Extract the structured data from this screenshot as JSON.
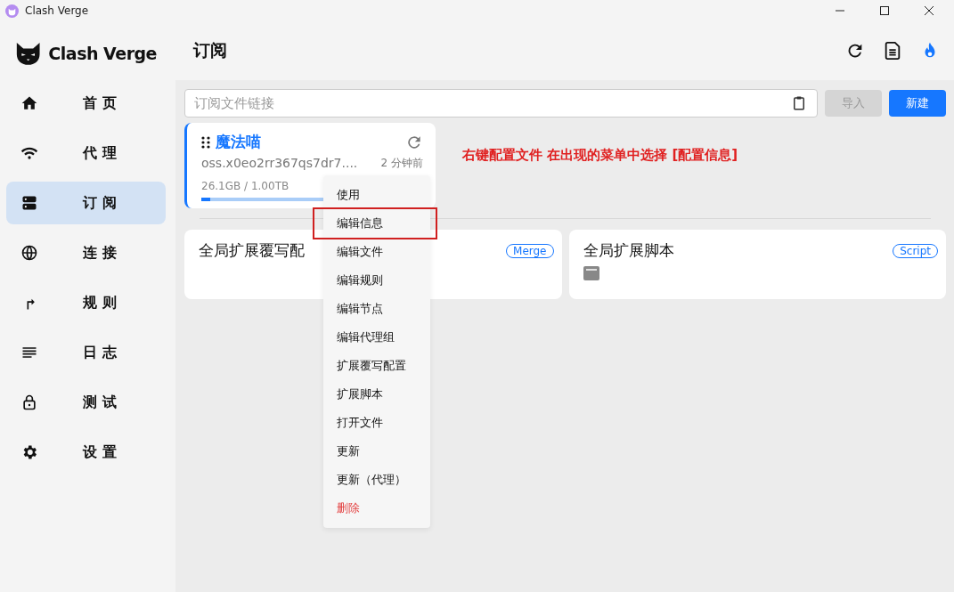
{
  "window": {
    "title": "Clash Verge"
  },
  "brand": {
    "name": "Clash Verge"
  },
  "sidebar": {
    "items": [
      {
        "kind": "home",
        "label": "首页",
        "selected": false
      },
      {
        "kind": "wifi",
        "label": "代理",
        "selected": false
      },
      {
        "kind": "server",
        "label": "订阅",
        "selected": true
      },
      {
        "kind": "globe",
        "label": "连接",
        "selected": false
      },
      {
        "kind": "route",
        "label": "规则",
        "selected": false
      },
      {
        "kind": "lines",
        "label": "日志",
        "selected": false
      },
      {
        "kind": "lock",
        "label": "测试",
        "selected": false
      },
      {
        "kind": "gear",
        "label": "设置",
        "selected": false
      }
    ]
  },
  "header": {
    "title": "订阅"
  },
  "import_bar": {
    "placeholder": "订阅文件链接",
    "import_button": {
      "label": "导入",
      "disabled": true
    },
    "new_button": {
      "label": "新建"
    }
  },
  "profile": {
    "name": "魔法喵",
    "selected": true,
    "url": "oss.x0eo2rr367qs7dr7....",
    "updated": "2 分钟前",
    "usage": "26.1GB / 1.00TB",
    "level": 0.026
  },
  "annotation": "右键配置文件 在出现的菜单中选择 [配置信息]",
  "enhance_cards": [
    {
      "title": "全局扩展覆写配",
      "tag": "Merge",
      "file_icon": false
    },
    {
      "title": "全局扩展脚本",
      "tag": "Script",
      "file_icon": true
    }
  ],
  "context_menu": [
    {
      "label": "使用",
      "kind": "normal",
      "highlighted": false
    },
    {
      "label": "编辑信息",
      "kind": "normal",
      "highlighted": true
    },
    {
      "label": "编辑文件",
      "kind": "normal",
      "highlighted": false
    },
    {
      "label": "编辑规则",
      "kind": "normal",
      "highlighted": false
    },
    {
      "label": "编辑节点",
      "kind": "normal",
      "highlighted": false
    },
    {
      "label": "编辑代理组",
      "kind": "normal",
      "highlighted": false
    },
    {
      "label": "扩展覆写配置",
      "kind": "normal",
      "highlighted": false
    },
    {
      "label": "扩展脚本",
      "kind": "normal",
      "highlighted": false
    },
    {
      "label": "打开文件",
      "kind": "normal",
      "highlighted": false
    },
    {
      "label": "更新",
      "kind": "normal",
      "highlighted": false
    },
    {
      "label": "更新（代理）",
      "kind": "normal",
      "highlighted": false
    },
    {
      "label": "删除",
      "kind": "danger",
      "highlighted": false
    }
  ]
}
